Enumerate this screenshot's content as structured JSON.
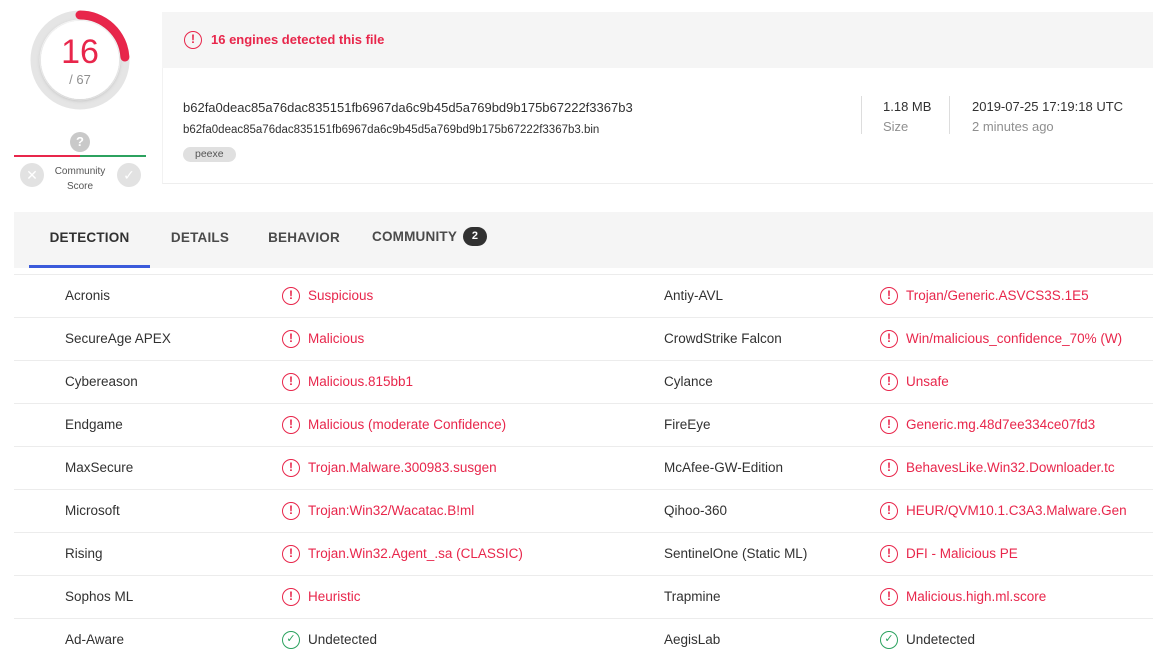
{
  "score": {
    "detected": "16",
    "total": "/ 67",
    "detected_fraction": 0.2388,
    "accent_color": "#e8264b"
  },
  "community": {
    "label_line1": "Community",
    "label_line2": "Score",
    "question_icon": "question-icon",
    "down_icon": "close-icon",
    "up_icon": "check-icon"
  },
  "banner": {
    "icon": "!",
    "text": "16 engines detected this file"
  },
  "file": {
    "hash": "b62fa0deac85a76dac835151fb6967da6c9b45d5a769bd9b175b67222f3367b3",
    "name": "b62fa0deac85a76dac835151fb6967da6c9b45d5a769bd9b175b67222f3367b3.bin",
    "tag": "peexe",
    "size_value": "1.18 MB",
    "size_label": "Size",
    "date_value": "2019-07-25 17:19:18 UTC",
    "date_label": "2 minutes ago"
  },
  "tabs": [
    {
      "label": "DETECTION"
    },
    {
      "label": "DETAILS"
    },
    {
      "label": "BEHAVIOR"
    },
    {
      "label": "COMMUNITY",
      "badge": "2"
    }
  ],
  "colors": {
    "malicious": "#e8264b",
    "clean": "#2ca25f",
    "tab_indicator": "#3b5bdb"
  },
  "results": [
    {
      "left": {
        "engine": "Acronis",
        "result": "Suspicious",
        "status": "bad"
      },
      "right": {
        "engine": "Antiy-AVL",
        "result": "Trojan/Generic.ASVCS3S.1E5",
        "status": "bad"
      }
    },
    {
      "left": {
        "engine": "SecureAge APEX",
        "result": "Malicious",
        "status": "bad"
      },
      "right": {
        "engine": "CrowdStrike Falcon",
        "result": "Win/malicious_confidence_70% (W)",
        "status": "bad"
      }
    },
    {
      "left": {
        "engine": "Cybereason",
        "result": "Malicious.815bb1",
        "status": "bad"
      },
      "right": {
        "engine": "Cylance",
        "result": "Unsafe",
        "status": "bad"
      }
    },
    {
      "left": {
        "engine": "Endgame",
        "result": "Malicious (moderate Confidence)",
        "status": "bad"
      },
      "right": {
        "engine": "FireEye",
        "result": "Generic.mg.48d7ee334ce07fd3",
        "status": "bad"
      }
    },
    {
      "left": {
        "engine": "MaxSecure",
        "result": "Trojan.Malware.300983.susgen",
        "status": "bad"
      },
      "right": {
        "engine": "McAfee-GW-Edition",
        "result": "BehavesLike.Win32.Downloader.tc",
        "status": "bad"
      }
    },
    {
      "left": {
        "engine": "Microsoft",
        "result": "Trojan:Win32/Wacatac.B!ml",
        "status": "bad"
      },
      "right": {
        "engine": "Qihoo-360",
        "result": "HEUR/QVM10.1.C3A3.Malware.Gen",
        "status": "bad"
      }
    },
    {
      "left": {
        "engine": "Rising",
        "result": "Trojan.Win32.Agent_.sa (CLASSIC)",
        "status": "bad"
      },
      "right": {
        "engine": "SentinelOne (Static ML)",
        "result": "DFI - Malicious PE",
        "status": "bad"
      }
    },
    {
      "left": {
        "engine": "Sophos ML",
        "result": "Heuristic",
        "status": "bad"
      },
      "right": {
        "engine": "Trapmine",
        "result": "Malicious.high.ml.score",
        "status": "bad"
      }
    },
    {
      "left": {
        "engine": "Ad-Aware",
        "result": "Undetected",
        "status": "good"
      },
      "right": {
        "engine": "AegisLab",
        "result": "Undetected",
        "status": "good"
      }
    }
  ]
}
